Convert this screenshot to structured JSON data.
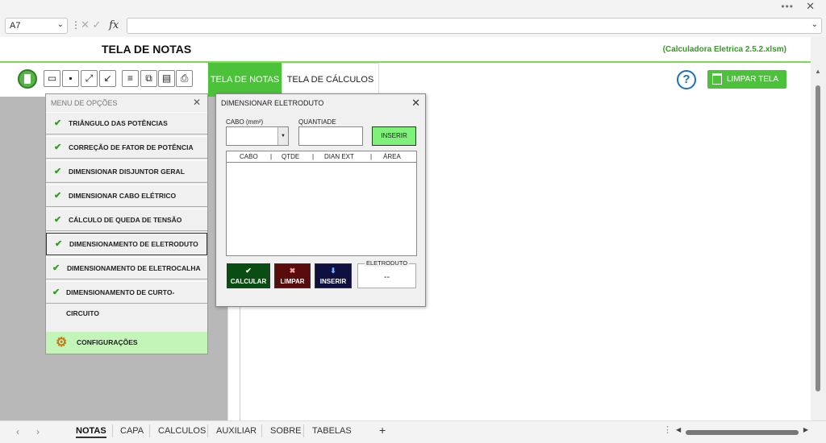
{
  "formula_bar": {
    "cell_ref": "A7",
    "fx_label": "fx"
  },
  "header": {
    "title": "TELA DE NOTAS",
    "filename": "(Calculadora Eletrica 2.5.2.xlsm)"
  },
  "tabs": {
    "notas": "TELA DE NOTAS",
    "calculos": "TELA DE CÁLCULOS"
  },
  "actions": {
    "help": "?",
    "clear": "LIMPAR TELA"
  },
  "menu": {
    "title": "MENU DE OPÇÕES",
    "items": [
      {
        "label": "TRIÂNGULO DAS POTÊNCIAS"
      },
      {
        "label": "CORREÇÃO DE FATOR DE POTÊNCIA"
      },
      {
        "label": "DIMENSIONAR DISJUNTOR GERAL"
      },
      {
        "label": "DIMENSIONAR CABO ELÉTRICO"
      },
      {
        "label": "CÁLCULO DE QUEDA DE TENSÃO"
      },
      {
        "label": "DIMENSIONAMENTO DE ELETRODUTO"
      },
      {
        "label": "DIMENSIONAMENTO DE ELETROCALHA"
      },
      {
        "label": "DIMENSIONAMENTO DE CURTO-CIRCUITO"
      }
    ],
    "config": "CONFIGURAÇÕES"
  },
  "dialog": {
    "title": "DIMENSIONAR ELETRODUTO",
    "cabo_label": "CABO (mm²)",
    "quantidade_label": "QUANTIADE",
    "inserir_top": "INSERIR",
    "columns": [
      "CABO",
      "QTDE",
      "DIAN EXT",
      "ÁREA"
    ],
    "btn_calcular": "CALCULAR",
    "btn_limpar": "LIMPAR",
    "btn_inserir": "INSERIR",
    "eletroduto_label": "ELETRODUTO",
    "eletroduto_value": "--"
  },
  "sheet_tabs": [
    "NOTAS",
    "CAPA",
    "CALCULOS",
    "AUXILIAR",
    "SOBRE",
    "TABELAS"
  ],
  "colors": {
    "accent_green": "#4cc23b",
    "file_green": "#2e9e1f",
    "calc_btn": "#0a4d12",
    "clear_btn": "#5a0c0c",
    "insert_btn": "#0f1040"
  }
}
